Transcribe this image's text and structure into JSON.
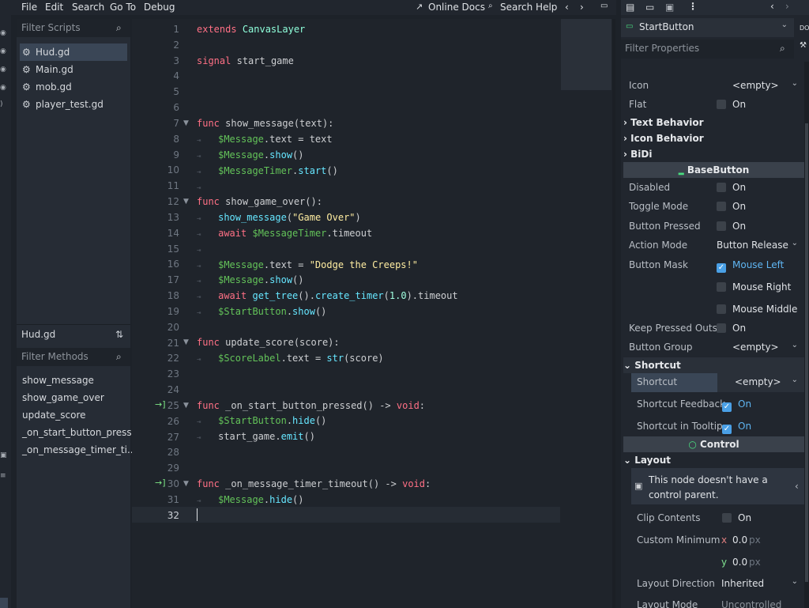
{
  "menu": {
    "items": [
      "File",
      "Edit",
      "Search",
      "Go To",
      "Debug"
    ],
    "online_docs": "Online Docs",
    "search_help": "Search Help"
  },
  "scripts": {
    "filter_placeholder": "Filter Scripts",
    "items": [
      "Hud.gd",
      "Main.gd",
      "mob.gd",
      "player_test.gd"
    ],
    "current_file": "Hud.gd",
    "methods_placeholder": "Filter Methods",
    "methods": [
      "show_message",
      "show_game_over",
      "update_score",
      "_on_start_button_press...",
      "_on_message_timer_ti..."
    ]
  },
  "editor": {
    "line_numbers": [
      "1",
      "2",
      "3",
      "4",
      "5",
      "6",
      "7",
      "8",
      "9",
      "10",
      "11",
      "12",
      "13",
      "14",
      "15",
      "16",
      "17",
      "18",
      "19",
      "20",
      "21",
      "22",
      "23",
      "24",
      "25",
      "26",
      "27",
      "28",
      "29",
      "30",
      "31",
      "32"
    ]
  },
  "inspector": {
    "node_name": "StartButton",
    "filter_placeholder": "Filter Properties",
    "icon_label": "Icon",
    "icon_value": "<empty>",
    "flat_label": "Flat",
    "on": "On",
    "text_behavior": "Text Behavior",
    "icon_behavior": "Icon Behavior",
    "bidi": "BiDi",
    "base_button": "BaseButton",
    "disabled": "Disabled",
    "toggle_mode": "Toggle Mode",
    "button_pressed": "Button Pressed",
    "action_mode": "Action Mode",
    "action_mode_value": "Button Release",
    "button_mask": "Button Mask",
    "mouse_left": "Mouse Left",
    "mouse_right": "Mouse Right",
    "mouse_middle": "Mouse Middle",
    "keep_pressed": "Keep Pressed Outsi",
    "button_group": "Button Group",
    "button_group_value": "<empty>",
    "shortcut_section": "Shortcut",
    "shortcut_label": "Shortcut",
    "shortcut_value": "<empty>",
    "shortcut_feedback": "Shortcut Feedback",
    "shortcut_tooltip": "Shortcut in Tooltip",
    "control": "Control",
    "layout": "Layout",
    "layout_warning": "This node doesn't have a control parent.",
    "clip_contents": "Clip Contents",
    "custom_minimum": "Custom Minimum",
    "x_axis": "x",
    "y_axis": "y",
    "min_x": "0.0",
    "min_y": "0.0",
    "px_unit": "px",
    "layout_direction": "Layout Direction",
    "layout_direction_value": "Inherited",
    "layout_mode": "Layout Mode",
    "layout_mode_value": "Uncontrolled"
  }
}
